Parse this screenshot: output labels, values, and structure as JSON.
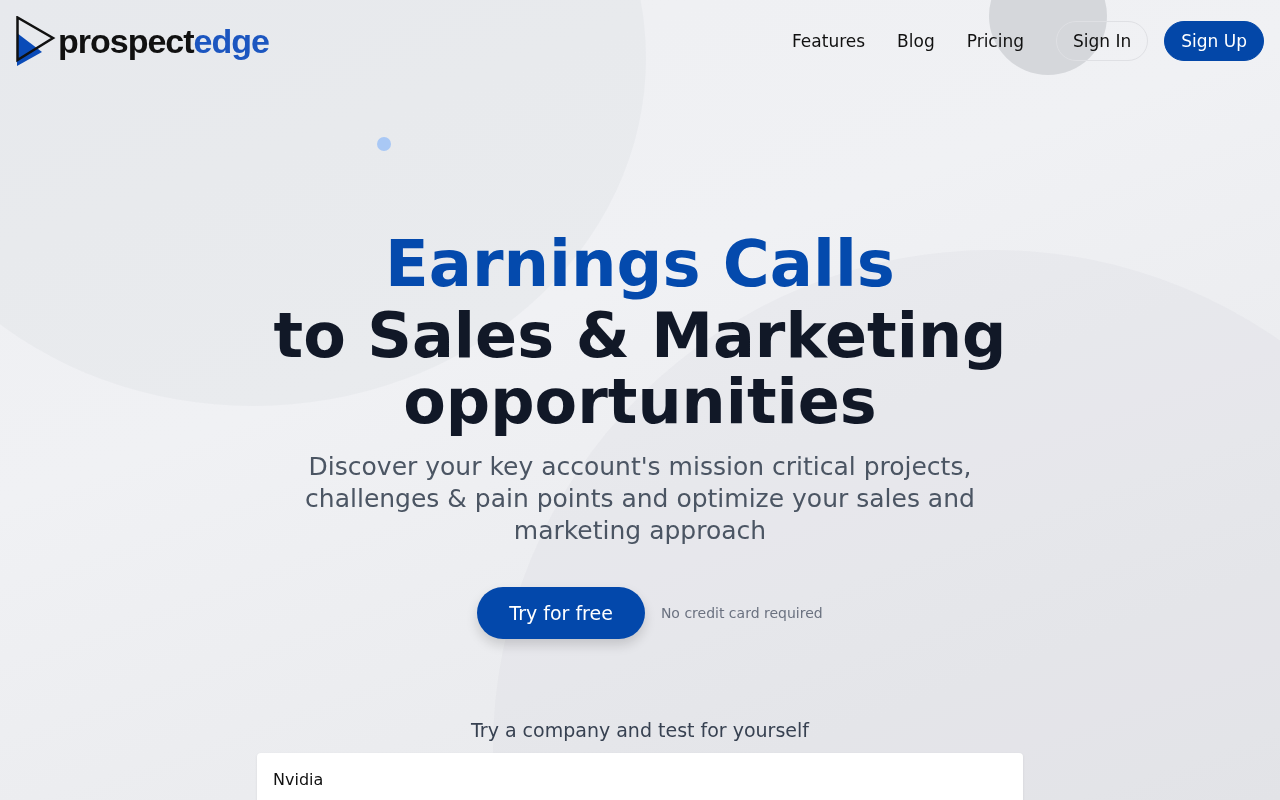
{
  "logo": {
    "dark_text": "prospect",
    "accent_text": "edge"
  },
  "nav": [
    {
      "label": "Features",
      "kind": "link"
    },
    {
      "label": "Blog",
      "kind": "link"
    },
    {
      "label": "Pricing",
      "kind": "link"
    },
    {
      "label": "Sign In",
      "kind": "outline"
    },
    {
      "label": "Sign Up",
      "kind": "filled"
    }
  ],
  "hero": {
    "highlight": "Earnings Calls",
    "title": "to Sales & Marketing opportunities",
    "subtitle": "Discover your key account's mission critical projects, challenges & pain points and optimize your sales and marketing approach",
    "cta": "Try for free",
    "cta_note": "No credit card required"
  },
  "demo": {
    "prompt": "Try a company and test for yourself",
    "company_field": {
      "value": "Nvidia"
    }
  }
}
